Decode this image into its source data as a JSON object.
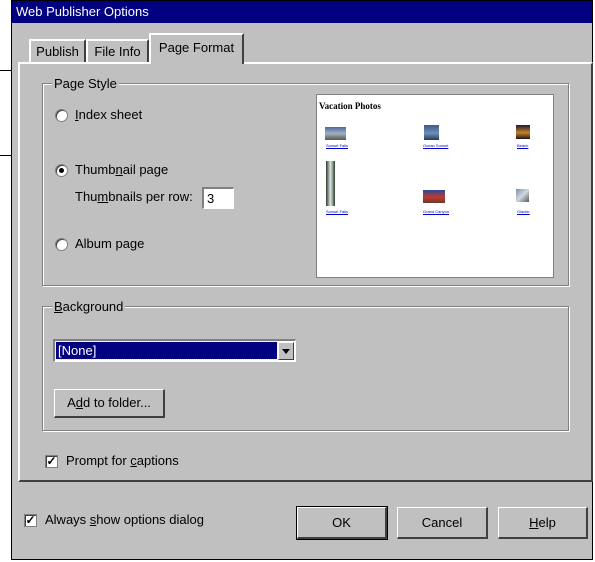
{
  "window": {
    "title": "Web Publisher Options"
  },
  "tabs": [
    {
      "label": "Publish"
    },
    {
      "label": "File Info"
    },
    {
      "label": "Page Format"
    }
  ],
  "page_style": {
    "legend": "Page Style",
    "options": {
      "index": {
        "pre": "",
        "key": "I",
        "post": "ndex sheet",
        "checked": false
      },
      "thumbnail": {
        "pre": "Thumb",
        "key": "n",
        "post": "ail page",
        "checked": true
      },
      "album": {
        "pre": "Album pa",
        "key": "g",
        "post": "e",
        "checked": false
      }
    },
    "per_row": {
      "pre": "Thu",
      "key": "m",
      "post": "bnails per row:",
      "value": "3"
    }
  },
  "preview": {
    "title": "Vacation Photos",
    "captions": [
      "Sunset Falls",
      "Ocean Sunset",
      "Beach",
      "Sunset Falls",
      "Grand Canyon",
      "Glacier"
    ]
  },
  "background": {
    "legend_key": "B",
    "legend_rest": "ackground",
    "select_value": "[None]",
    "add_button": {
      "pre": "A",
      "key": "d",
      "post": "d to folder..."
    }
  },
  "prompt_captions": {
    "pre": "Prompt for ",
    "key": "c",
    "post": "aptions",
    "checked": true
  },
  "always_show": {
    "pre": "Always ",
    "key": "s",
    "post": "how options dialog",
    "checked": true
  },
  "buttons": {
    "ok": "OK",
    "cancel": "Cancel",
    "help_key": "H",
    "help_rest": "elp"
  },
  "colors": {
    "title_bar": "#000080",
    "face": "#c0c0c0",
    "selection": "#000080"
  }
}
